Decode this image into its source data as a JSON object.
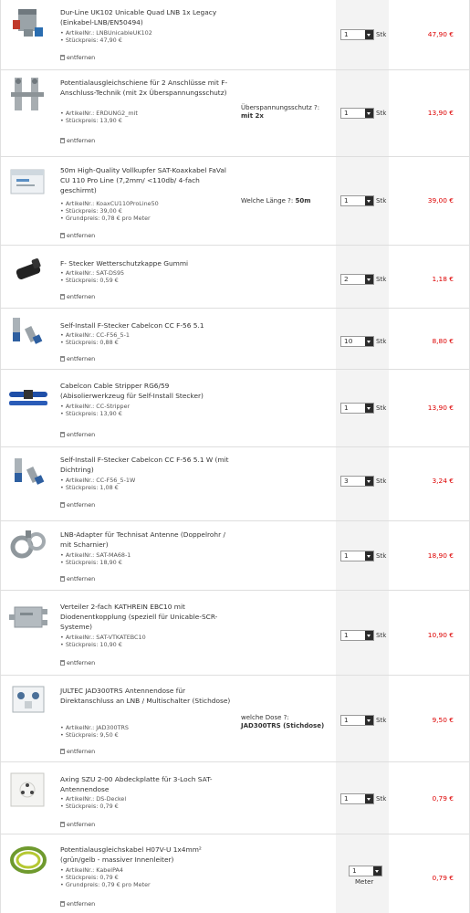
{
  "labels": {
    "remove": "entfernen"
  },
  "colors": {
    "price": "#dd0000",
    "qty_column_bg": "#f3f3f3",
    "border": "#dedede"
  },
  "items": [
    {
      "image": "lnb-icon",
      "title": "Dur-Line UK102 Unicable Quad LNB 1x Legacy (Einkabel-LNB/EN50494)",
      "details": [
        "ArtikelNr.: LNBUnicableUK102",
        "Stückpreis: 47,90 €"
      ],
      "option_label": "",
      "option_value": "",
      "qty": "1",
      "unit": "Stk",
      "price": "47,90 €"
    },
    {
      "image": "grounding-block-icon",
      "title": "Potentialausgleichschiene für 2 Anschlüsse mit F-Anschluss-Technik (mit 2x Überspannungsschutz)",
      "details": [
        "ArtikelNr.: ERDUNG2_mit",
        "Stückpreis: 13,90 €"
      ],
      "option_label": "Überspannungsschutz ?:",
      "option_value": "mit 2x",
      "qty": "1",
      "unit": "Stk",
      "price": "13,90 €"
    },
    {
      "image": "cable-box-icon",
      "title": "50m High-Quality Vollkupfer SAT-Koaxkabel FaVal CU 110 Pro Line (7,2mm/ <110db/ 4-fach geschirmt)",
      "details": [
        "ArtikelNr.: KoaxCU110ProLine50",
        "Stückpreis: 39,00 €",
        "Grundpreis: 0,78 € pro Meter"
      ],
      "option_label": "Welche Länge ?:",
      "option_value": "50m",
      "qty": "1",
      "unit": "Stk",
      "price": "39,00 €"
    },
    {
      "image": "rubber-cap-icon",
      "title": "F- Stecker Wetterschutzkappe Gummi",
      "details": [
        "ArtikelNr.: SAT-DS95",
        "Stückpreis: 0,59 €"
      ],
      "option_label": "",
      "option_value": "",
      "qty": "2",
      "unit": "Stk",
      "price": "1,18 €"
    },
    {
      "image": "f-connector-icon",
      "title": "Self-Install F-Stecker Cabelcon CC F-56 5.1",
      "details": [
        "ArtikelNr.: CC-F56_5-1",
        "Stückpreis: 0,88 €"
      ],
      "option_label": "",
      "option_value": "",
      "qty": "10",
      "unit": "Stk",
      "price": "8,80 €"
    },
    {
      "image": "cable-stripper-icon",
      "title": "Cabelcon Cable Stripper RG6/59 (Abisolierwerkzeug für Self-Install Stecker)",
      "details": [
        "ArtikelNr.: CC-Stripper",
        "Stückpreis: 13,90 €"
      ],
      "option_label": "",
      "option_value": "",
      "qty": "1",
      "unit": "Stk",
      "price": "13,90 €"
    },
    {
      "image": "f-connector-icon",
      "title": "Self-Install F-Stecker Cabelcon CC F-56 5.1 W (mit Dichtring)",
      "details": [
        "ArtikelNr.: CC-F56_5-1W",
        "Stückpreis: 1,08 €"
      ],
      "option_label": "",
      "option_value": "",
      "qty": "3",
      "unit": "Stk",
      "price": "3,24 €"
    },
    {
      "image": "lnb-adapter-icon",
      "title": "LNB-Adapter für Technisat Antenne (Doppelrohr / mit Scharnier)",
      "details": [
        "ArtikelNr.: SAT-MA68-1",
        "Stückpreis: 18,90 €"
      ],
      "option_label": "",
      "option_value": "",
      "qty": "1",
      "unit": "Stk",
      "price": "18,90 €"
    },
    {
      "image": "splitter-icon",
      "title": "Verteiler 2-fach KATHREIN EBC10 mit Diodenentkopplung (speziell für Unicable-SCR-Systeme)",
      "details": [
        "ArtikelNr.: SAT-VTKATEBC10",
        "Stückpreis: 10,90 €"
      ],
      "option_label": "",
      "option_value": "",
      "qty": "1",
      "unit": "Stk",
      "price": "10,90 €"
    },
    {
      "image": "antenna-socket-icon",
      "title": "JULTEC JAD300TRS Antennendose für Direktanschluss an LNB / Multischalter (Stichdose)",
      "details": [
        "ArtikelNr.: JAD300TRS",
        "Stückpreis: 9,50 €"
      ],
      "option_label": "welche Dose ?:",
      "option_value": "JAD300TRS (Stichdose)",
      "qty": "1",
      "unit": "Stk",
      "price": "9,50 €"
    },
    {
      "image": "cover-plate-icon",
      "title": "Axing SZU 2-00 Abdeckplatte für 3-Loch SAT-Antennendose",
      "details": [
        "ArtikelNr.: DS-Deckel",
        "Stückpreis: 0,79 €"
      ],
      "option_label": "",
      "option_value": "",
      "qty": "1",
      "unit": "Stk",
      "price": "0,79 €"
    },
    {
      "image": "cable-coil-icon",
      "title": "Potentialausgleichskabel H07V-U 1x4mm² (grün/gelb - massiver Innenleiter)",
      "details": [
        "ArtikelNr.: KabelPA4",
        "Stückpreis: 0,79 €",
        "Grundpreis: 0,79 € pro Meter"
      ],
      "option_label": "",
      "option_value": "",
      "qty": "1",
      "unit": "Meter",
      "price": "0,79 €"
    }
  ]
}
